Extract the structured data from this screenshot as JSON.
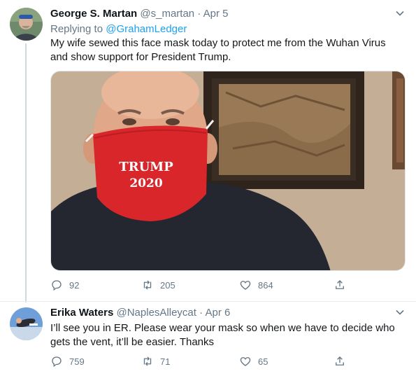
{
  "tweets": [
    {
      "author_name": "George S. Martan",
      "handle": "@s_martan",
      "separator": "·",
      "date": "Apr 5",
      "replying_prefix": "Replying to ",
      "replying_to": "@GrahamLedger",
      "text_lines": [
        "My wife sewed this face mask today to protect me from the Wuhan Virus",
        "and show support for President Trump."
      ],
      "media": {
        "mask_text_line1": "TRUMP",
        "mask_text_line2": "2020"
      },
      "actions": {
        "replies": "92",
        "retweets": "205",
        "likes": "864"
      }
    },
    {
      "author_name": "Erika Waters",
      "handle": "@NaplesAlleycat",
      "separator": "·",
      "date": "Apr 6",
      "text_lines": [
        "I’ll see you in ER. Please wear your mask so when we have to decide who",
        "gets the vent, it’ll be easier. Thanks"
      ],
      "actions": {
        "replies": "759",
        "retweets": "71",
        "likes": "65"
      }
    }
  ],
  "colors": {
    "link": "#1da1f2",
    "muted": "#657786",
    "mask": "#d8262a",
    "divider": "#e6ecf0"
  },
  "icons": [
    "reply-icon",
    "retweet-icon",
    "like-icon",
    "share-icon",
    "chevron-down-icon"
  ]
}
